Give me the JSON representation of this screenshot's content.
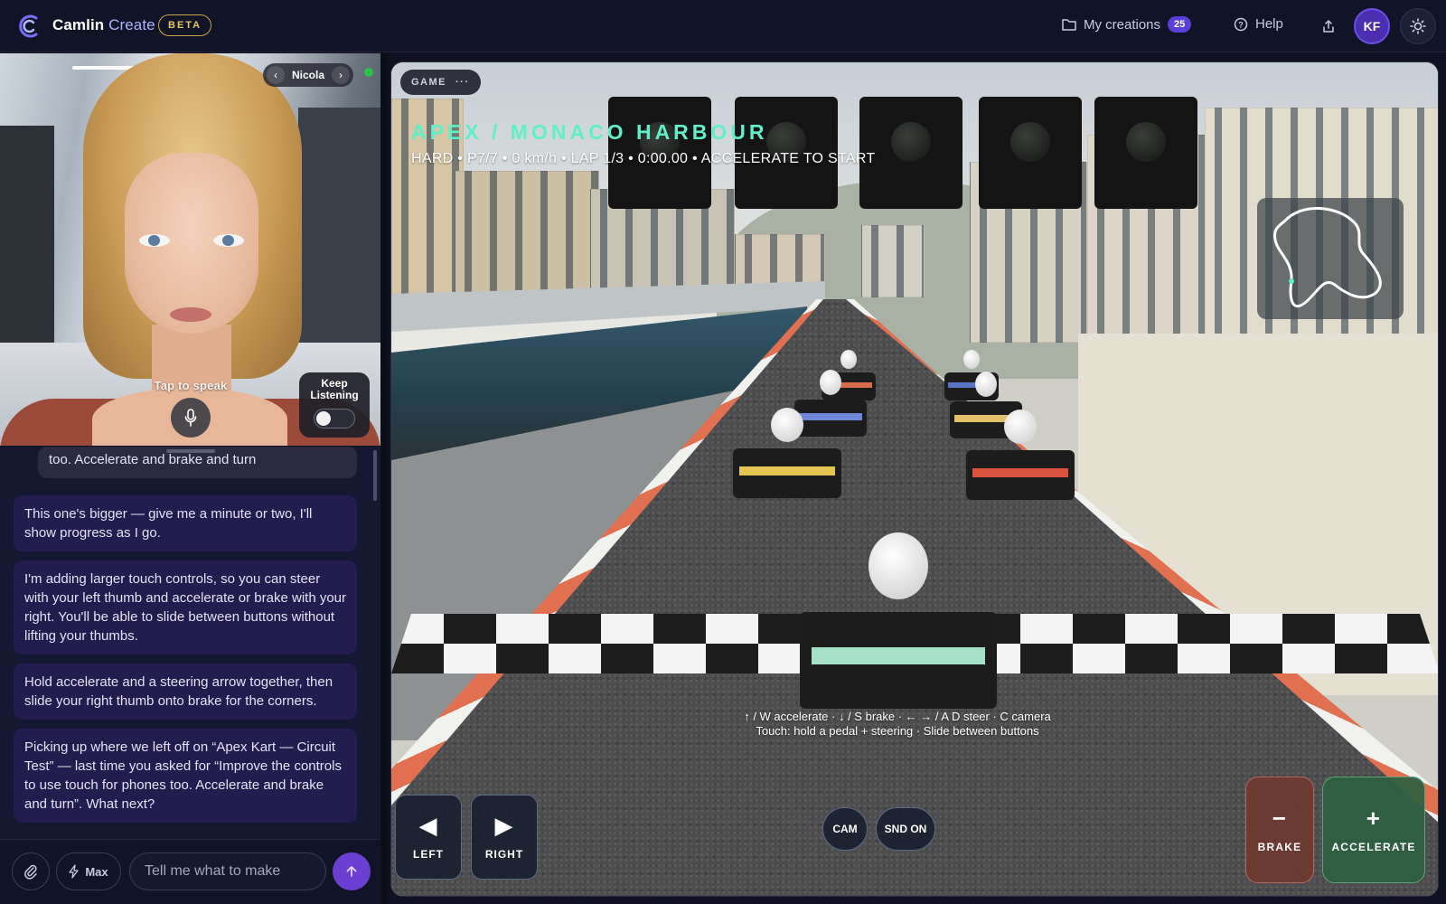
{
  "app": {
    "brand_main": "Camlin",
    "brand_accent": "Create",
    "beta_label": "BETA",
    "colors": {
      "accent": "#5b3fd9",
      "title_cyan": "#5ff0c8",
      "brake": "#6e3a30",
      "accelerate": "#2c6040"
    }
  },
  "header": {
    "my_creations_label": "My creations",
    "my_creations_count": "25",
    "help_label": "Help",
    "avatar_initials": "KF",
    "icons": [
      "folder-icon",
      "help-circle-icon",
      "share-icon",
      "sun-icon"
    ]
  },
  "avatar_panel": {
    "persona_name": "Nicola",
    "tap_to_speak": "Tap to speak",
    "keep_listening": "Keep Listening",
    "keep_listening_on": false
  },
  "chat": {
    "messages": [
      {
        "role": "user",
        "text": "too. Accelerate and brake and turn"
      },
      {
        "role": "assistant",
        "text": "This one's bigger — give me a minute or two, I'll show progress as I go."
      },
      {
        "role": "assistant",
        "text": "I'm adding larger touch controls, so you can steer with your left thumb and accelerate or brake with your right. You'll be able to slide between buttons without lifting your thumbs."
      },
      {
        "role": "assistant",
        "text": "Hold accelerate and a steering arrow together, then slide your right thumb onto brake for the corners."
      },
      {
        "role": "assistant",
        "text": "Picking up where we left off on “Apex Kart — Circuit Test” — last time you asked for “Improve the controls to use touch for phones too. Accelerate and brake and turn”. What next?"
      }
    ]
  },
  "composer": {
    "model_label": "Max",
    "placeholder": "Tell me what to make",
    "value": ""
  },
  "game": {
    "chip_label": "GAME",
    "title": "APEX / MONACO HARBOUR",
    "status": "HARD • P7/7 • 0 km/h • LAP 1/3 • 0:00.00 • ACCELERATE TO START",
    "hint_line1": "↑ / W accelerate · ↓ / S brake · ← → / A D steer · C camera",
    "hint_line2": "Touch: hold a pedal + steering · Slide between buttons",
    "controls": {
      "left": "LEFT",
      "right": "RIGHT",
      "cam": "CAM",
      "sound": "SND ON",
      "brake": "BRAKE",
      "accelerate": "ACCELERATE"
    }
  }
}
